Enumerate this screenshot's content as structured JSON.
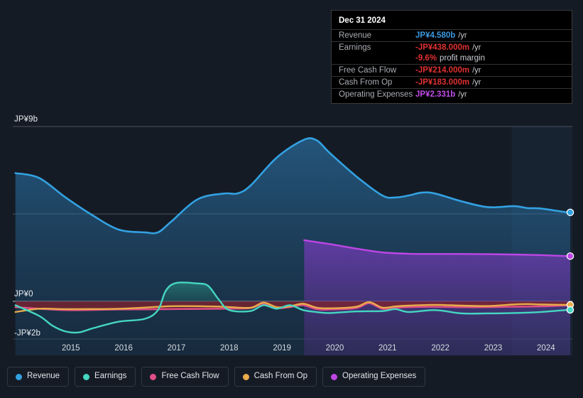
{
  "chart_data": {
    "type": "area",
    "title": "",
    "xlabel": "",
    "ylabel": "",
    "currency": "JP¥",
    "ylim": [
      -2,
      9
    ],
    "grid": true,
    "y_ticks": [
      {
        "label": "JP¥9b",
        "value": 9
      },
      {
        "label": "JP¥0",
        "value": 0
      },
      {
        "label": "-JP¥2b",
        "value": -2
      }
    ],
    "x_ticks": [
      "2015",
      "2016",
      "2017",
      "2018",
      "2019",
      "2020",
      "2021",
      "2022",
      "2023",
      "2024"
    ],
    "x_range": [
      2014.4,
      2025.0
    ],
    "highlight_band": {
      "start": 2023.85,
      "end": 2025.0
    },
    "legend_position": "bottom",
    "series": [
      {
        "name": "Revenue",
        "color": "#32a2e2",
        "fill": true,
        "x": [
          2014.45,
          2014.9,
          2015.4,
          2015.9,
          2016.4,
          2016.9,
          2017.15,
          2017.4,
          2017.9,
          2018.4,
          2018.65,
          2018.9,
          2019.4,
          2019.9,
          2020.15,
          2020.4,
          2020.9,
          2021.4,
          2021.65,
          2021.9,
          2022.15,
          2022.4,
          2022.9,
          2023.4,
          2023.9,
          2024.15,
          2024.4,
          2024.9,
          2024.96
        ],
        "values": [
          6.6,
          6.35,
          5.35,
          4.45,
          3.7,
          3.55,
          3.55,
          4.1,
          5.25,
          5.55,
          5.55,
          5.95,
          7.4,
          8.3,
          8.3,
          7.65,
          6.45,
          5.45,
          5.35,
          5.45,
          5.6,
          5.55,
          5.15,
          4.85,
          4.9,
          4.8,
          4.78,
          4.58,
          4.58
        ]
      },
      {
        "name": "Earnings",
        "color": "#45d6c0",
        "fill": true,
        "x": [
          2014.45,
          2014.9,
          2015.15,
          2015.4,
          2015.65,
          2015.9,
          2016.4,
          2016.9,
          2017.15,
          2017.3,
          2017.5,
          2017.9,
          2018.1,
          2018.3,
          2018.5,
          2018.9,
          2019.15,
          2019.4,
          2019.65,
          2019.9,
          2020.15,
          2020.4,
          2020.9,
          2021.4,
          2021.65,
          2021.9,
          2022.4,
          2022.9,
          2023.4,
          2023.9,
          2024.4,
          2024.9,
          2024.96
        ],
        "values": [
          -0.2,
          -0.75,
          -1.25,
          -1.55,
          -1.6,
          -1.4,
          -1.05,
          -0.9,
          -0.45,
          0.55,
          0.95,
          0.92,
          0.8,
          0.1,
          -0.45,
          -0.5,
          -0.2,
          -0.38,
          -0.2,
          -0.45,
          -0.55,
          -0.6,
          -0.52,
          -0.5,
          -0.4,
          -0.55,
          -0.45,
          -0.62,
          -0.62,
          -0.6,
          -0.55,
          -0.44,
          -0.44
        ]
      },
      {
        "name": "Free Cash Flow",
        "color": "#e04f87",
        "fill": true,
        "x": [
          2014.45,
          2015.4,
          2016.4,
          2017.4,
          2018.4,
          2018.9,
          2019.15,
          2019.4,
          2019.65,
          2019.9,
          2020.15,
          2020.4,
          2020.9,
          2021.15,
          2021.4,
          2021.65,
          2021.9,
          2022.4,
          2022.9,
          2023.4,
          2023.9,
          2024.4,
          2024.9,
          2024.96
        ],
        "values": [
          -0.3,
          -0.45,
          -0.42,
          -0.4,
          -0.38,
          -0.35,
          -0.12,
          -0.35,
          -0.3,
          -0.2,
          -0.4,
          -0.42,
          -0.35,
          -0.1,
          -0.38,
          -0.33,
          -0.3,
          -0.28,
          -0.3,
          -0.3,
          -0.28,
          -0.26,
          -0.21,
          -0.21
        ]
      },
      {
        "name": "Cash From Op",
        "color": "#e8ac4a",
        "fill": false,
        "x": [
          2014.45,
          2014.9,
          2015.4,
          2016.4,
          2017.15,
          2017.4,
          2017.9,
          2018.4,
          2018.9,
          2019.15,
          2019.4,
          2019.65,
          2019.9,
          2020.15,
          2020.4,
          2020.9,
          2021.15,
          2021.4,
          2021.65,
          2021.9,
          2022.4,
          2022.9,
          2023.4,
          2023.9,
          2024.15,
          2024.4,
          2024.9,
          2024.96
        ],
        "values": [
          -0.55,
          -0.38,
          -0.4,
          -0.38,
          -0.28,
          -0.25,
          -0.25,
          -0.28,
          -0.33,
          -0.06,
          -0.3,
          -0.25,
          -0.12,
          -0.32,
          -0.36,
          -0.28,
          -0.04,
          -0.32,
          -0.26,
          -0.22,
          -0.18,
          -0.22,
          -0.24,
          -0.16,
          -0.14,
          -0.16,
          -0.18,
          -0.18
        ]
      },
      {
        "name": "Operating Expenses",
        "color": "#bc46e4",
        "fill": true,
        "x": [
          2019.92,
          2020.4,
          2020.9,
          2021.4,
          2021.9,
          2022.4,
          2022.9,
          2023.4,
          2023.9,
          2024.4,
          2024.9,
          2024.96
        ],
        "values": [
          3.15,
          2.95,
          2.72,
          2.52,
          2.45,
          2.44,
          2.44,
          2.43,
          2.41,
          2.38,
          2.33,
          2.33
        ]
      }
    ],
    "end_markers": [
      {
        "series": "Revenue",
        "value": 4.58,
        "color": "#32a2e2"
      },
      {
        "series": "Operating Expenses",
        "value": 2.33,
        "color": "#bc46e4"
      },
      {
        "series": "Cash From Op",
        "value": -0.18,
        "color": "#e8ac4a"
      },
      {
        "series": "Earnings",
        "value": -0.44,
        "color": "#45d6c0"
      }
    ]
  },
  "tooltip": {
    "date": "Dec 31 2024",
    "rows": [
      {
        "label": "Revenue",
        "value": "JP¥4.580b",
        "unit": "/yr",
        "color": "#3b9ae0"
      },
      {
        "label": "Earnings",
        "value": "-JP¥438.000m",
        "unit": "/yr",
        "color": "#e03131"
      },
      {
        "label": "",
        "value": "-9.6%",
        "sub": "profit margin",
        "color": "#e03131"
      },
      {
        "label": "Free Cash Flow",
        "value": "-JP¥214.000m",
        "unit": "/yr",
        "color": "#e03131"
      },
      {
        "label": "Cash From Op",
        "value": "-JP¥183.000m",
        "unit": "/yr",
        "color": "#e03131"
      },
      {
        "label": "Operating Expenses",
        "value": "JP¥2.331b",
        "unit": "/yr",
        "color": "#c04ce8"
      }
    ]
  },
  "legend": {
    "items": [
      {
        "label": "Revenue",
        "color": "#32a2e2"
      },
      {
        "label": "Earnings",
        "color": "#45d6c0"
      },
      {
        "label": "Free Cash Flow",
        "color": "#e04f87"
      },
      {
        "label": "Cash From Op",
        "color": "#e8ac4a"
      },
      {
        "label": "Operating Expenses",
        "color": "#bc46e4"
      }
    ]
  }
}
